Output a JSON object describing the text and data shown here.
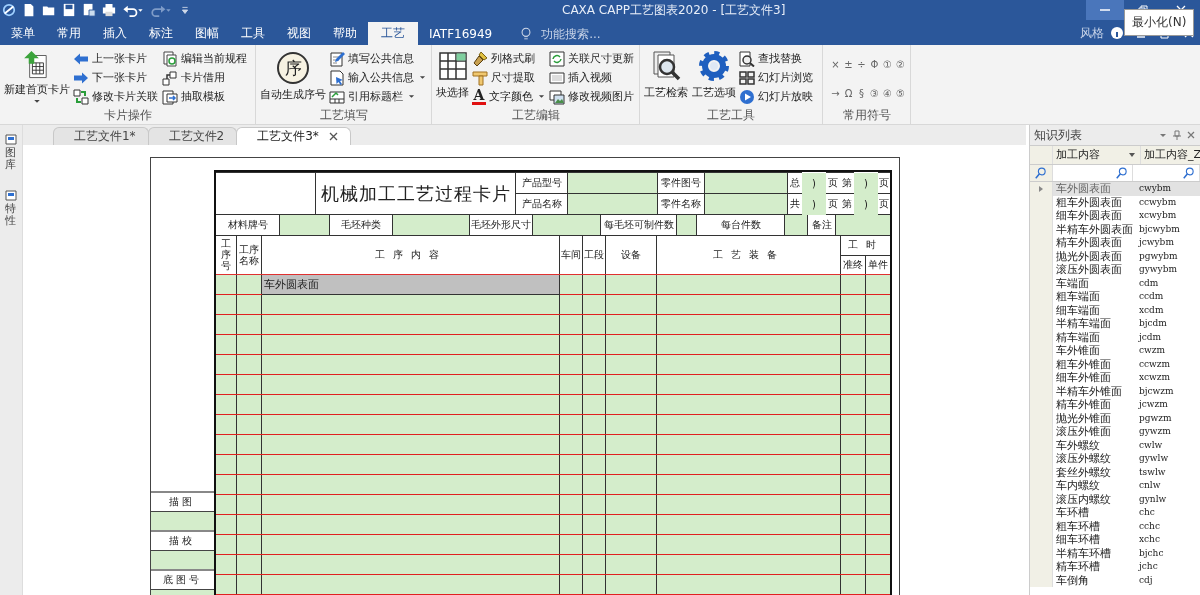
{
  "title_bar": {
    "title": "CAXA CAPP工艺图表2020 - [工艺文件3]",
    "tooltip": "最小化(N)",
    "controls": [
      {
        "kind": "minimize",
        "hovered": true
      },
      {
        "kind": "restore",
        "hovered": false
      },
      {
        "kind": "close",
        "hovered": false
      }
    ]
  },
  "menu_tabs": [
    {
      "label": "菜单",
      "selected": false
    },
    {
      "label": "常用",
      "selected": false
    },
    {
      "label": "插入",
      "selected": false
    },
    {
      "label": "标注",
      "selected": false
    },
    {
      "label": "图幅",
      "selected": false
    },
    {
      "label": "工具",
      "selected": false
    },
    {
      "label": "视图",
      "selected": false
    },
    {
      "label": "帮助",
      "selected": false
    },
    {
      "label": "工艺",
      "selected": true
    },
    {
      "label": "IATF16949",
      "selected": false
    }
  ],
  "search": {
    "placeholder": "功能搜索..."
  },
  "style_label": "风格",
  "ribbon": {
    "groups": [
      {
        "title": "卡片操作",
        "large": [
          {
            "label": "新建首页卡片",
            "kind": "sheet-arrow",
            "dropdown": true
          }
        ],
        "small": [
          {
            "label": "上一张卡片",
            "kind": "arrow-left",
            "dropdown": false
          },
          {
            "label": "下一张卡片",
            "kind": "arrow-right",
            "dropdown": false
          },
          {
            "label": "修改卡片关联",
            "kind": "linked-squares",
            "dropdown": false
          },
          {
            "label": "编辑当前规程",
            "kind": "documents-circle",
            "dropdown": false
          },
          {
            "label": "卡片借用",
            "kind": "linked-boxes",
            "dropdown": false
          },
          {
            "label": "抽取模板",
            "kind": "documents-arrow",
            "dropdown": false
          }
        ]
      },
      {
        "title": "工艺填写",
        "large": [
          {
            "label": "自动生成序号",
            "glyph": "序",
            "dropdown": false
          }
        ],
        "small": [
          {
            "label": "填写公共信息",
            "kind": "document-pencil",
            "dropdown": false
          },
          {
            "label": "输入公共信息",
            "kind": "document-cursor",
            "dropdown": true
          },
          {
            "label": "引用标题栏",
            "kind": "table-chart",
            "dropdown": true
          }
        ]
      },
      {
        "title": "工艺编辑",
        "large": [
          {
            "label": "块选择",
            "kind": "grid",
            "dropdown": false
          }
        ],
        "small": [
          {
            "label": "列格式刷",
            "kind": "brush",
            "dropdown": false
          },
          {
            "label": "尺寸提取",
            "kind": "ruler",
            "dropdown": false
          },
          {
            "label": "文字颜色",
            "glyph": "A",
            "dropdown": true
          },
          {
            "label": "关联尺寸更新",
            "kind": "refresh-frame",
            "dropdown": false
          },
          {
            "label": "插入视频",
            "kind": "video-frame",
            "dropdown": false
          },
          {
            "label": "修改视频图片",
            "kind": "picture-frame",
            "dropdown": false
          }
        ]
      },
      {
        "title": "工艺工具",
        "large": [
          {
            "label": "工艺检索",
            "kind": "documents-magnifier",
            "dropdown": false
          },
          {
            "label": "工艺选项",
            "kind": "gear",
            "dropdown": false
          }
        ],
        "small": [
          {
            "label": "查找替换",
            "kind": "document-magnifier",
            "dropdown": false
          },
          {
            "label": "幻灯片浏览",
            "kind": "four-squares",
            "dropdown": false
          },
          {
            "label": "幻灯片放映",
            "kind": "play",
            "dropdown": false
          }
        ]
      },
      {
        "title": "常用符号",
        "symbols": [
          "×",
          "±",
          "÷",
          "Φ",
          "①",
          "②",
          "→",
          "Ω",
          "§",
          "③",
          "④",
          "⑤"
        ]
      }
    ]
  },
  "side_panels": [
    "图库",
    "特性"
  ],
  "doc_tabs": [
    {
      "label": "工艺文件1*",
      "selected": false,
      "closable": false
    },
    {
      "label": "工艺文件2",
      "selected": false,
      "closable": false
    },
    {
      "label": "工艺文件3*",
      "selected": true,
      "closable": true
    }
  ],
  "card": {
    "title": "机械加工工艺过程卡片",
    "header_fields": [
      "产品型号",
      "零件图号",
      "产品名称",
      "零件名称"
    ],
    "pages": [
      {
        "label": "总",
        "mark": ")",
        "unit": "页"
      },
      {
        "label": "第",
        "mark": ")",
        "unit": "页"
      },
      {
        "label": "共",
        "mark": ")",
        "unit": "页"
      },
      {
        "label": "第",
        "mark": ")",
        "unit": "页"
      }
    ],
    "material_fields": [
      "材料牌号",
      "毛坯种类",
      "毛坯外形尺寸",
      "每毛坯可制件数",
      "每台件数",
      "备注"
    ],
    "columns": [
      "工序号",
      "工序名称",
      "工序内容",
      "车间",
      "工段",
      "设备",
      "工艺装备",
      "工时"
    ],
    "time_subcolumns": [
      "准终",
      "单件"
    ],
    "rows": [
      {
        "content": "车外圆表面",
        "selected": true
      }
    ],
    "side_labels": [
      "描图",
      "描校",
      "底图号"
    ]
  },
  "knowledge": {
    "title": "知识列表",
    "columns": [
      "加工内容",
      "加工内容_Z"
    ],
    "rows": [
      {
        "name": "车外圆表面",
        "code": "cwybm",
        "selected": true
      },
      {
        "name": "粗车外圆表面",
        "code": "ccwybm",
        "selected": false
      },
      {
        "name": "细车外圆表面",
        "code": "xcwybm",
        "selected": false
      },
      {
        "name": "半精车外圆表面",
        "code": "bjcwybm",
        "selected": false
      },
      {
        "name": "精车外圆表面",
        "code": "jcwybm",
        "selected": false
      },
      {
        "name": "抛光外圆表面",
        "code": "pgwybm",
        "selected": false
      },
      {
        "name": "滚压外圆表面",
        "code": "gywybm",
        "selected": false
      },
      {
        "name": "车端面",
        "code": "cdm",
        "selected": false
      },
      {
        "name": "粗车端面",
        "code": "ccdm",
        "selected": false
      },
      {
        "name": "细车端面",
        "code": "xcdm",
        "selected": false
      },
      {
        "name": "半精车端面",
        "code": "bjcdm",
        "selected": false
      },
      {
        "name": "精车端面",
        "code": "jcdm",
        "selected": false
      },
      {
        "name": "车外锥面",
        "code": "cwzm",
        "selected": false
      },
      {
        "name": "粗车外锥面",
        "code": "ccwzm",
        "selected": false
      },
      {
        "name": "细车外锥面",
        "code": "xcwzm",
        "selected": false
      },
      {
        "name": "半精车外锥面",
        "code": "bjcwzm",
        "selected": false
      },
      {
        "name": "精车外锥面",
        "code": "jcwzm",
        "selected": false
      },
      {
        "name": "抛光外锥面",
        "code": "pgwzm",
        "selected": false
      },
      {
        "name": "滚压外锥面",
        "code": "gywzm",
        "selected": false
      },
      {
        "name": "车外螺纹",
        "code": "cwlw",
        "selected": false
      },
      {
        "name": "滚压外螺纹",
        "code": "gywlw",
        "selected": false
      },
      {
        "name": "套丝外螺纹",
        "code": "tswlw",
        "selected": false
      },
      {
        "name": "车内螺纹",
        "code": "cnlw",
        "selected": false
      },
      {
        "name": "滚压内螺纹",
        "code": "gynlw",
        "selected": false
      },
      {
        "name": "车环槽",
        "code": "chc",
        "selected": false
      },
      {
        "name": "粗车环槽",
        "code": "cchc",
        "selected": false
      },
      {
        "name": "细车环槽",
        "code": "xchc",
        "selected": false
      },
      {
        "name": "半精车环槽",
        "code": "bjchc",
        "selected": false
      },
      {
        "name": "精车环槽",
        "code": "jchc",
        "selected": false
      },
      {
        "name": "车倒角",
        "code": "cdj",
        "selected": false
      }
    ]
  }
}
